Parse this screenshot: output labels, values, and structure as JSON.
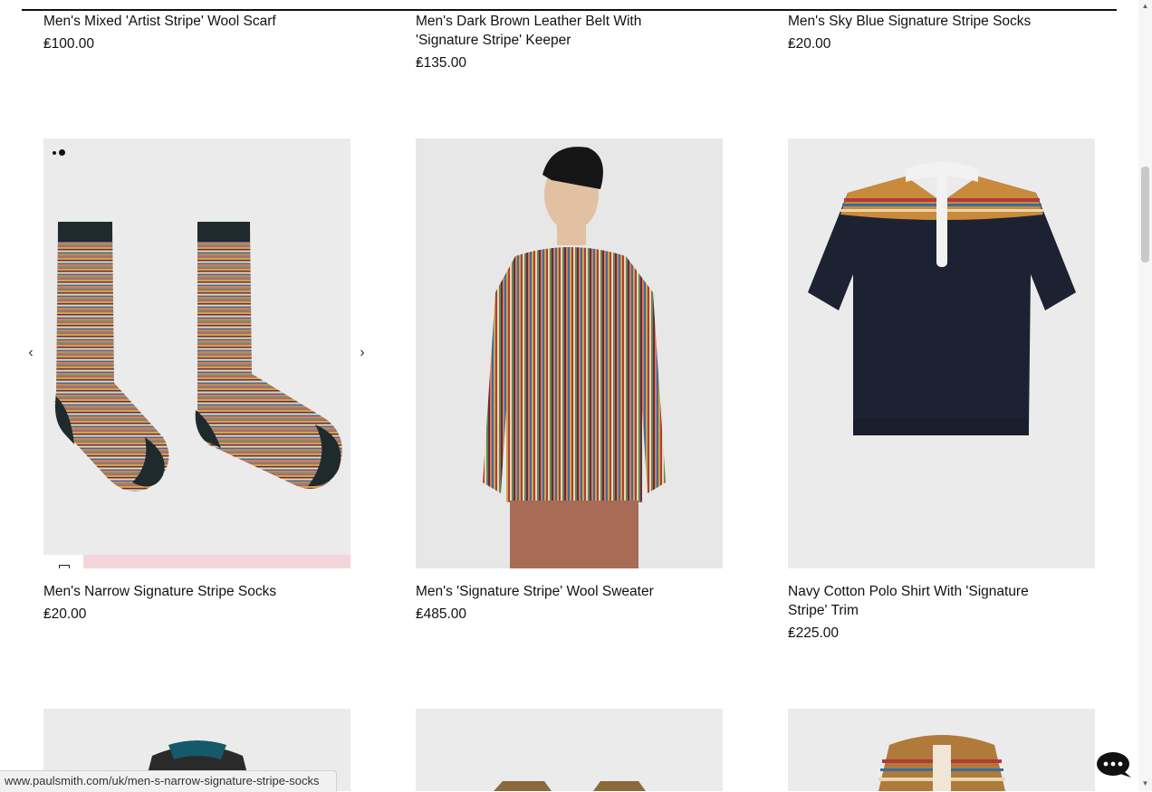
{
  "row1": [
    {
      "name": "Men's Mixed 'Artist Stripe' Wool Scarf",
      "price": "₤100.00"
    },
    {
      "name": "Men's Dark Brown Leather Belt With 'Signature Stripe' Keeper",
      "price": "₤135.00"
    },
    {
      "name": "Men's Sky Blue Signature Stripe Socks",
      "price": "₤20.00"
    }
  ],
  "row2": [
    {
      "name": "Men's Narrow Signature Stripe Socks",
      "price": "₤20.00"
    },
    {
      "name": "Men's 'Signature Stripe' Wool Sweater",
      "price": "₤485.00"
    },
    {
      "name": "Navy Cotton Polo Shirt With 'Signature Stripe' Trim",
      "price": "₤225.00"
    }
  ],
  "carousel": {
    "prev_icon": "chevron-left-icon",
    "next_icon": "chevron-right-icon",
    "slide_count": 2,
    "active_slide": 2
  },
  "status_url": "www.paulsmith.com/uk/men-s-narrow-signature-stripe-socks",
  "colors": {
    "image_bg": "#ebebeb",
    "quick_add_bg": "#f3d6db",
    "text": "#111111"
  }
}
